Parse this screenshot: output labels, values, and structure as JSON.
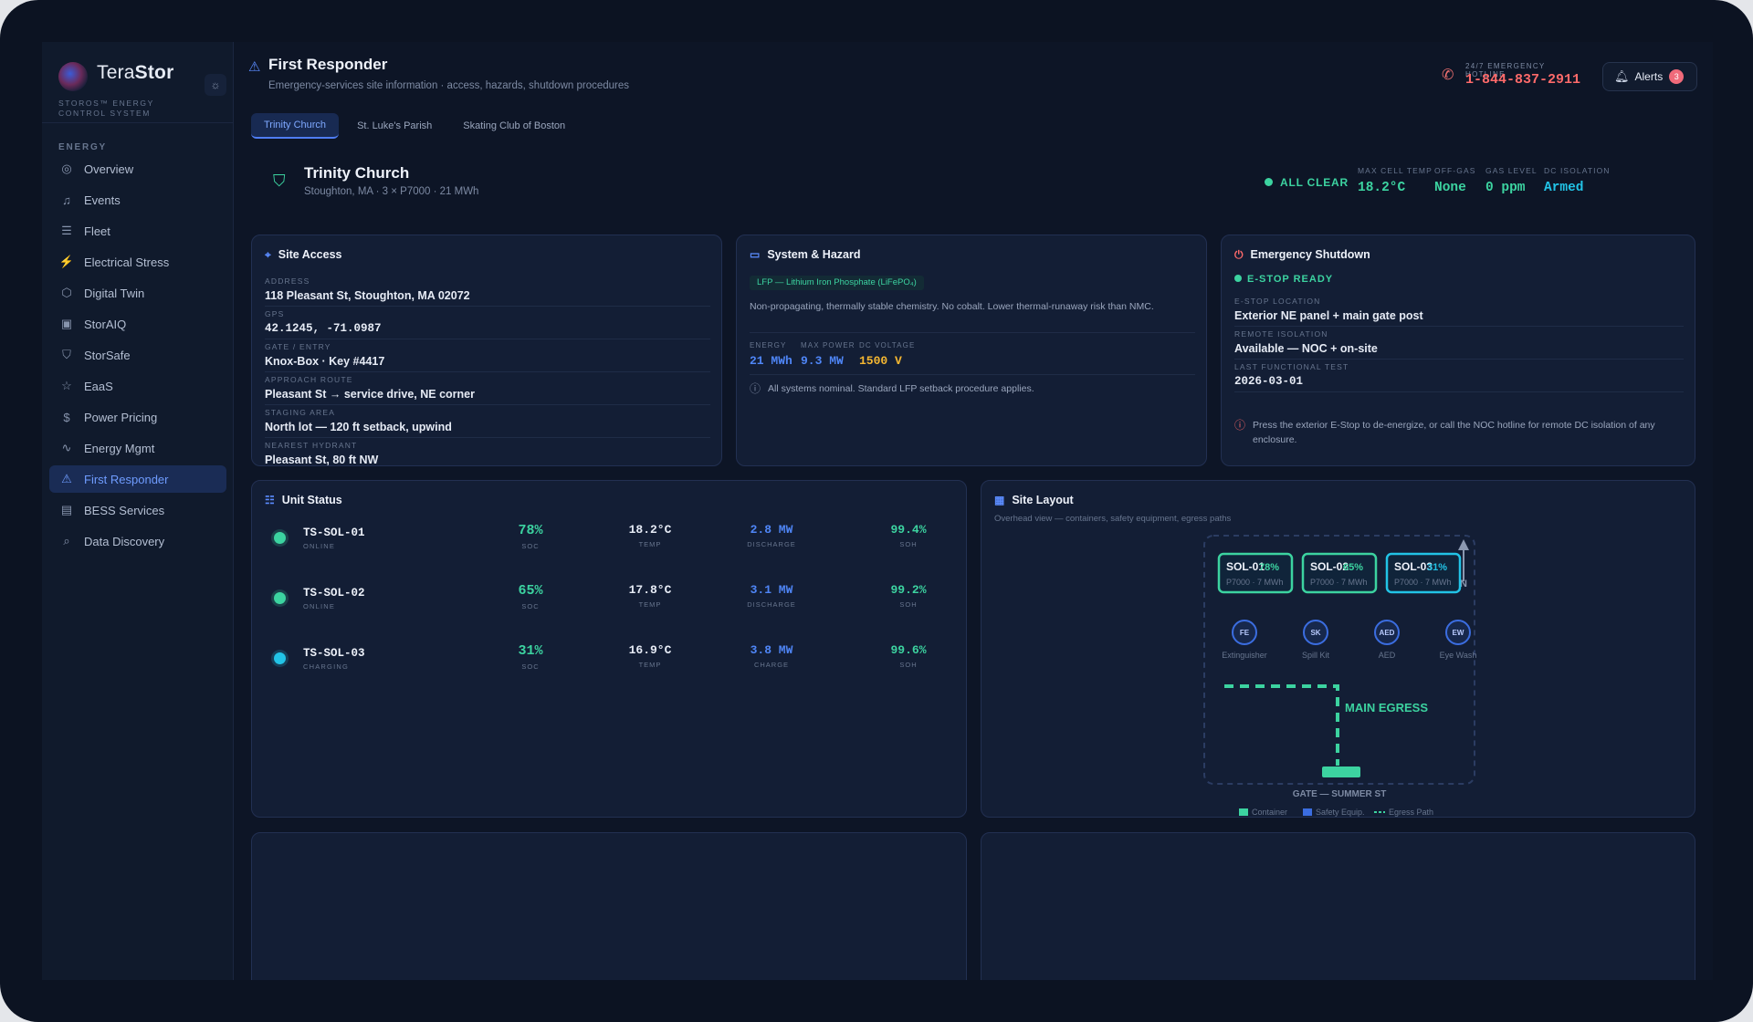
{
  "brand": {
    "name_light": "Tera",
    "name_bold": "Stor",
    "subtitle": "STOROS™ ENERGY CONTROL SYSTEM"
  },
  "sidebar": {
    "section": "ENERGY",
    "items": [
      {
        "label": "Overview",
        "icon": "globe-icon"
      },
      {
        "label": "Events",
        "icon": "bell-icon"
      },
      {
        "label": "Fleet",
        "icon": "layers-icon"
      },
      {
        "label": "Electrical Stress",
        "icon": "plug-icon"
      },
      {
        "label": "Digital Twin",
        "icon": "cube-icon"
      },
      {
        "label": "StorAIQ",
        "icon": "chip-icon"
      },
      {
        "label": "StorSafe",
        "icon": "shield-icon"
      },
      {
        "label": "EaaS",
        "icon": "star-icon"
      },
      {
        "label": "Power Pricing",
        "icon": "dollar-icon"
      },
      {
        "label": "Energy Mgmt",
        "icon": "pulse-icon"
      },
      {
        "label": "First Responder",
        "icon": "siren-icon",
        "active": true
      },
      {
        "label": "BESS Services",
        "icon": "book-icon"
      },
      {
        "label": "Data Discovery",
        "icon": "search-icon"
      }
    ]
  },
  "header": {
    "title": "First Responder",
    "subtitle": "Emergency-services site information · access, hazards, shutdown procedures",
    "hotline_label": "24/7 EMERGENCY HOTLINE",
    "hotline_number": "1-844-837-2911",
    "alerts_label": "Alerts",
    "alerts_count": "3"
  },
  "tabs": [
    "Trinity Church",
    "St. Luke's Parish",
    "Skating Club of Boston"
  ],
  "site": {
    "name": "Trinity Church",
    "desc": "Stoughton, MA · 3 × P7000 · 21 MWh",
    "status": "ALL CLEAR",
    "metrics": [
      {
        "label": "MAX CELL TEMP",
        "value": "18.2°C",
        "color": "#3cd3a0"
      },
      {
        "label": "OFF-GAS",
        "value": "None",
        "color": "#3cd3a0"
      },
      {
        "label": "GAS LEVEL",
        "value": "0 ppm",
        "color": "#3cd3a0"
      },
      {
        "label": "DC ISOLATION",
        "value": "Armed",
        "color": "#22c3e6"
      }
    ]
  },
  "access": {
    "title": "Site Access",
    "fields": [
      {
        "label": "ADDRESS",
        "value": "118 Pleasant St, Stoughton, MA 02072"
      },
      {
        "label": "GPS",
        "value": "42.1245, -71.0987",
        "mono": true
      },
      {
        "label": "GATE / ENTRY",
        "value": "Knox-Box · Key #4417"
      },
      {
        "label": "APPROACH ROUTE",
        "value": "Pleasant St → service drive, NE corner"
      },
      {
        "label": "STAGING AREA",
        "value": "North lot — 120 ft setback, upwind"
      },
      {
        "label": "NEAREST HYDRANT",
        "value": "Pleasant St, 80 ft NW"
      }
    ]
  },
  "hazard": {
    "title": "System & Hazard",
    "chemistry": "LFP — Lithium Iron Phosphate (LiFePO₄)",
    "description": "Non-propagating, thermally stable chemistry. No cobalt. Lower thermal-runaway risk than NMC.",
    "metrics": [
      {
        "label": "ENERGY",
        "value": "21 MWh",
        "color": "#4f86f7"
      },
      {
        "label": "MAX POWER",
        "value": "9.3 MW",
        "color": "#4f86f7"
      },
      {
        "label": "DC VOLTAGE",
        "value": "1500 V",
        "color": "#f5b731"
      }
    ],
    "note": "All systems nominal. Standard LFP setback procedure applies."
  },
  "shutdown": {
    "title": "Emergency Shutdown",
    "status": "E-STOP READY",
    "fields": [
      {
        "label": "E-STOP LOCATION",
        "value": "Exterior NE panel + main gate post"
      },
      {
        "label": "REMOTE ISOLATION",
        "value": "Available — NOC + on-site"
      },
      {
        "label": "LAST FUNCTIONAL TEST",
        "value": "2026-03-01",
        "mono": true
      }
    ],
    "note": "Press the exterior E-Stop to de-energize, or call the NOC hotline for remote DC isolation of any enclosure."
  },
  "units": {
    "title": "Unit Status",
    "rows": [
      {
        "id": "TS-SOL-01",
        "status": "ONLINE",
        "dot": "#3cd3a0",
        "soc": "78%",
        "soc_label": "SOC",
        "temp": "18.2°C",
        "temp_label": "TEMP",
        "power": "2.8 MW",
        "power_label": "DISCHARGE",
        "soh": "99.4%",
        "soh_label": "SOH"
      },
      {
        "id": "TS-SOL-02",
        "status": "ONLINE",
        "dot": "#3cd3a0",
        "soc": "65%",
        "soc_label": "SOC",
        "temp": "17.8°C",
        "temp_label": "TEMP",
        "power": "3.1 MW",
        "power_label": "DISCHARGE",
        "soh": "99.2%",
        "soh_label": "SOH"
      },
      {
        "id": "TS-SOL-03",
        "status": "CHARGING",
        "dot": "#22c3e6",
        "soc": "31%",
        "soc_label": "SOC",
        "temp": "16.9°C",
        "temp_label": "TEMP",
        "power": "3.8 MW",
        "power_label": "CHARGE",
        "soh": "99.6%",
        "soh_label": "SOH"
      }
    ]
  },
  "site_layout": {
    "title": "Site Layout",
    "subtitle": "Overhead view — containers, safety equipment, egress paths",
    "containers": [
      {
        "name": "SOL-01",
        "overlay": "78%",
        "model": "P7000 · 7 MWh",
        "color": "#3cd3a0"
      },
      {
        "name": "SOL-02",
        "overlay": "65%",
        "model": "P7000 · 7 MWh",
        "color": "#3cd3a0"
      },
      {
        "name": "SOL-03",
        "overlay": "31%",
        "model": "P7000 · 7 MWh",
        "color": "#22c3e6"
      }
    ],
    "equipment": [
      {
        "code": "FE",
        "label": "Extinguisher"
      },
      {
        "code": "SK",
        "label": "Spill Kit"
      },
      {
        "code": "AED",
        "label": "AED"
      },
      {
        "code": "EW",
        "label": "Eye Wash"
      }
    ],
    "north": "N",
    "egress_label": "MAIN EGRESS",
    "gate_label": "GATE — SUMMER ST",
    "legend": [
      "Container",
      "Safety Equip.",
      "Egress Path"
    ]
  },
  "colors": {
    "accent": "#5b8cff",
    "ok": "#3cd3a0",
    "cyan": "#22c3e6",
    "alert": "#ff6a6a"
  }
}
